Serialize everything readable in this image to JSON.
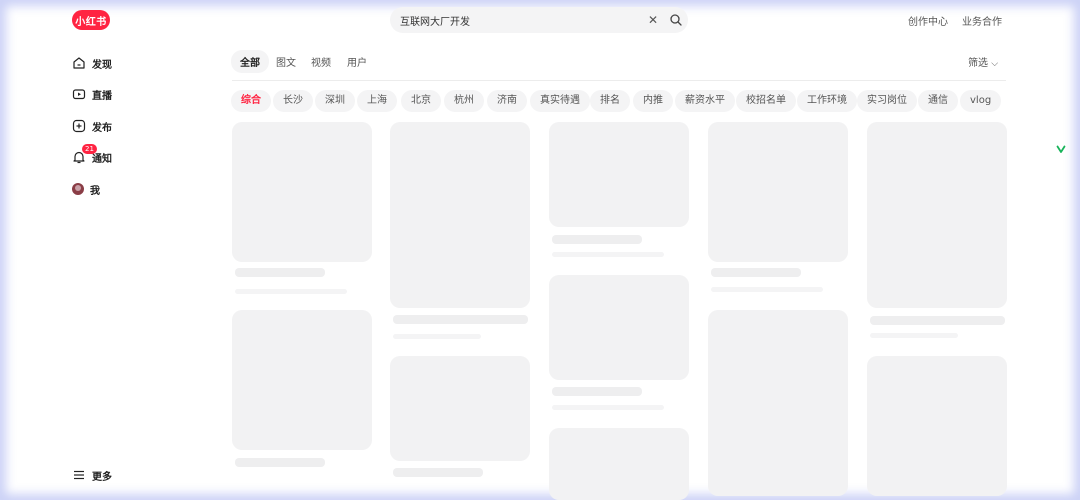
{
  "header": {
    "logo_text": "小红书",
    "search_value": "互联网大厂开发",
    "creator_center": "创作中心",
    "business": "业务合作"
  },
  "sidebar": {
    "items": [
      {
        "label": "发现",
        "icon": "home-icon"
      },
      {
        "label": "直播",
        "icon": "live-icon"
      },
      {
        "label": "发布",
        "icon": "plus-icon"
      },
      {
        "label": "通知",
        "icon": "bell-icon",
        "badge": "21"
      },
      {
        "label": "我",
        "icon": "avatar"
      }
    ],
    "more_label": "更多"
  },
  "tabs": [
    "全部",
    "图文",
    "视频",
    "用户"
  ],
  "filter_label": "筛选",
  "chips": [
    "综合",
    "长沙",
    "深圳",
    "上海",
    "北京",
    "杭州",
    "济南",
    "真实待遇",
    "排名",
    "内推",
    "薪资水平",
    "校招名单",
    "工作环境",
    "实习岗位",
    "通信",
    "vlog"
  ],
  "colors": {
    "brand": "#ff2442",
    "skeleton": "#f2f2f3"
  }
}
